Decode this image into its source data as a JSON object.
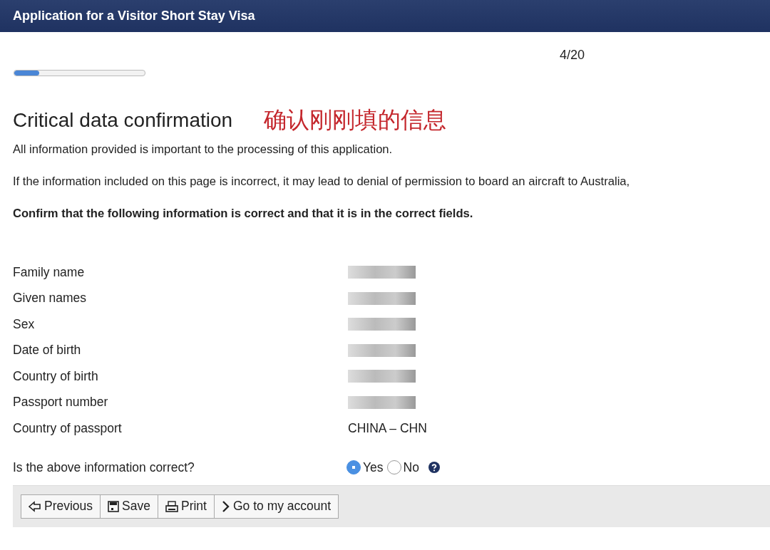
{
  "window": {
    "title": "Application for a Visitor Short Stay Visa"
  },
  "progress": {
    "counter": "4/20",
    "level": 0.19
  },
  "heading": "Critical data confirmation",
  "annotation": "确认刚刚填的信息",
  "paragraphs": [
    {
      "text": "All information provided is important to the processing of this application.",
      "bold": false
    },
    {
      "text": "If the information included on this page is incorrect, it may lead to denial of permission to board an aircraft to Australia,",
      "bold": false
    },
    {
      "text": "Confirm that the following information is correct and that it is in the correct fields.",
      "bold": true
    }
  ],
  "fields": [
    {
      "label": "Family name",
      "redacted": true
    },
    {
      "label": "Given names",
      "redacted": true
    },
    {
      "label": "Sex",
      "redacted": true
    },
    {
      "label": "Date of birth",
      "redacted": true
    },
    {
      "label": "Country of birth",
      "redacted": true
    },
    {
      "label": "Passport number",
      "redacted": true
    },
    {
      "label": "Country of passport",
      "redacted": false,
      "value": "CHINA – CHN"
    }
  ],
  "question": {
    "label": "Is the above information correct?",
    "options": [
      {
        "label": "Yes",
        "selected": true
      },
      {
        "label": "No",
        "selected": false
      }
    ]
  },
  "buttons": [
    {
      "kind": "previous",
      "label": "Previous"
    },
    {
      "kind": "save",
      "label": "Save"
    },
    {
      "kind": "print",
      "label": "Print"
    },
    {
      "kind": "next",
      "label": "Go to my account"
    }
  ]
}
